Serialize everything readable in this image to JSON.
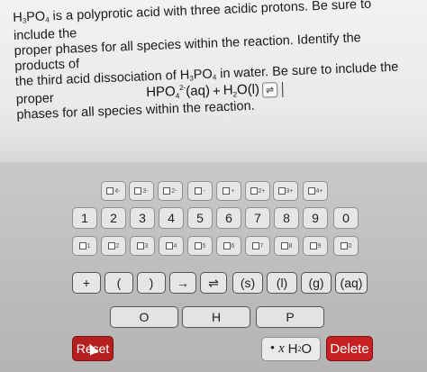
{
  "question": {
    "line1": [
      "H",
      "3",
      "PO",
      "4",
      " is a polyprotic acid with three acidic protons. Be sure to include the"
    ],
    "line2": "proper phases for all species within the reaction. Identify the products of",
    "line3": [
      "the third acid dissociation of H",
      "3",
      "PO",
      "4",
      " in water. Be sure to include the proper"
    ],
    "line4": "phases for all species within the reaction."
  },
  "reaction": {
    "species1": "HPO",
    "species1_sub": "4",
    "species1_sup": "2-",
    "species1_phase": "(aq)",
    "plus": "+",
    "species2_a": "H",
    "species2_sub": "2",
    "species2_b": "O(l)",
    "arrow": "⇌"
  },
  "keypad": {
    "charges": [
      {
        "sup": "4-"
      },
      {
        "sup": "3-"
      },
      {
        "sup": "2-"
      },
      {
        "sup": "-"
      },
      {
        "sup": "+"
      },
      {
        "sup": "2+"
      },
      {
        "sup": "3+"
      },
      {
        "sup": "4+"
      }
    ],
    "digits": [
      "1",
      "2",
      "3",
      "4",
      "5",
      "6",
      "7",
      "8",
      "9",
      "0"
    ],
    "subscripts": [
      "1",
      "2",
      "3",
      "4",
      "5",
      "6",
      "7",
      "8",
      "9",
      "0"
    ],
    "ops": [
      "+",
      "(",
      ")",
      "→",
      "⇌",
      "(s)",
      "(l)",
      "(g)",
      "(aq)"
    ],
    "elements": [
      "O",
      "H",
      "P"
    ],
    "reset": "Reset",
    "water_dot": "•",
    "water_x": "x",
    "water_h": "H",
    "water_sub": "2",
    "water_o": "O",
    "delete": "Delete"
  }
}
